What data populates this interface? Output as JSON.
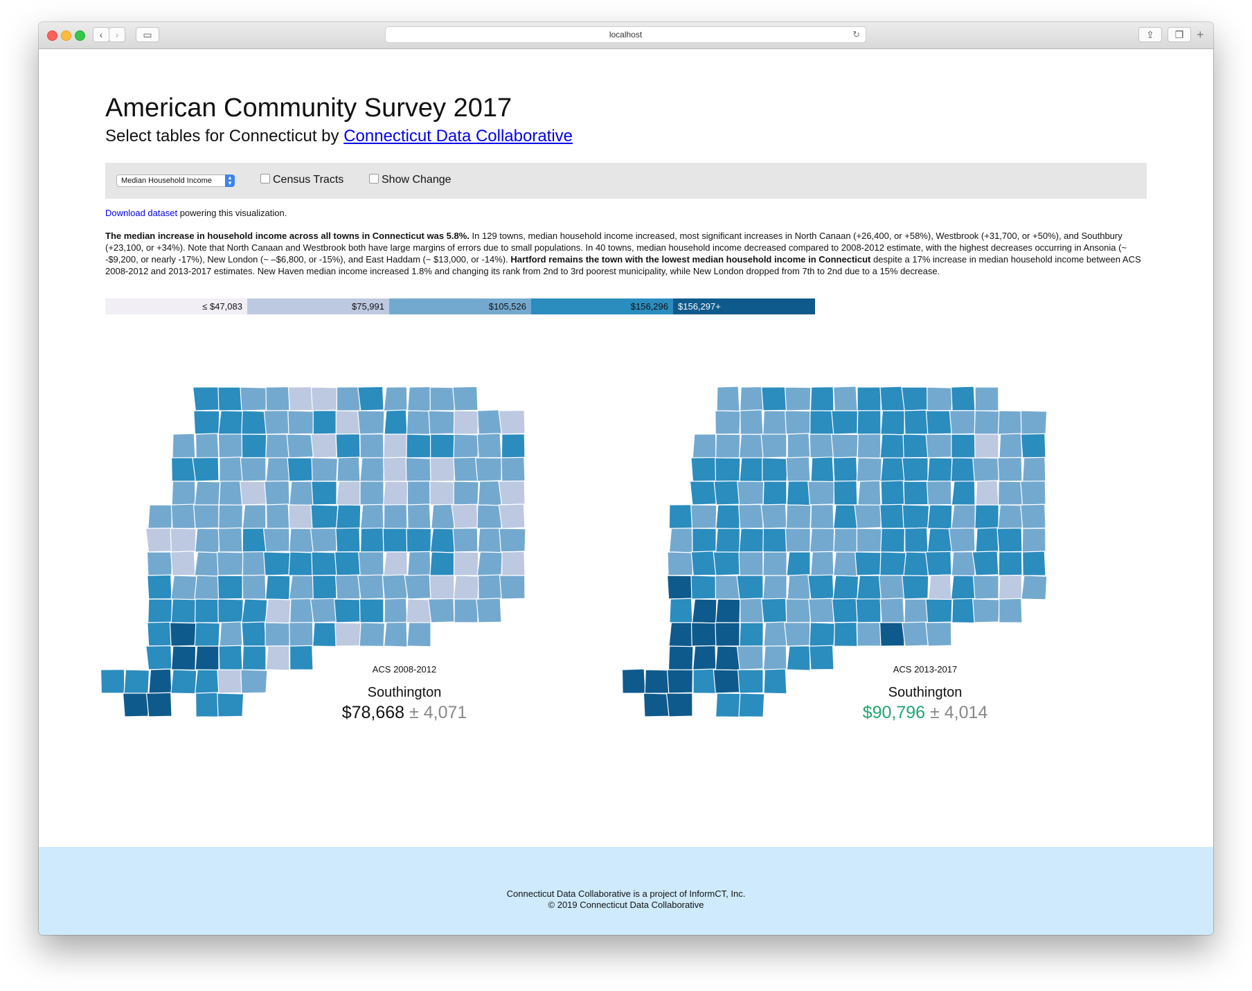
{
  "browser": {
    "url": "localhost"
  },
  "page": {
    "title": "American Community Survey 2017",
    "subtitle_prefix": "Select tables for Connecticut by",
    "subtitle_link": "Connecticut Data Collaborative"
  },
  "controls": {
    "select_value": "Median Household Income",
    "census_tracts_label": "Census Tracts",
    "census_tracts_checked": false,
    "show_change_label": "Show Change",
    "show_change_checked": false
  },
  "download": {
    "link_text": "Download dataset",
    "rest_text": " powering this visualization."
  },
  "summary": {
    "bold1": "The median increase in household income across all towns in Connecticut was 5.8%.",
    "text1": " In 129 towns, median household income increased, most significant increases in North Canaan (+26,400, or +58%), Westbrook (+31,700, or +50%), and Southbury (+23,100, or +34%). Note that North Canaan and Westbrook both have large margins of errors due to small populations. In 40 towns, median household income decreased compared to 2008-2012 estimate, with the highest decreases occurring in Ansonia (~ -$9,200, or nearly -17%), New London (~ –$6,800, or -15%), and East Haddam (~ $13,000, or -14%). ",
    "bold2": "Hartford remains the town with the lowest median household income in Connecticut",
    "text2": " despite a 17% increase in median household income between ACS 2008-2012 and 2013-2017 estimates. New Haven median income increased 1.8% and changing its rank from 2nd to 3rd poorest municipality, while New London dropped from 7th to 2nd due to a 15% decrease."
  },
  "legend": [
    {
      "label": "≤ $47,083",
      "color": "#f1eef6"
    },
    {
      "label": "$75,991",
      "color": "#bdc9e1"
    },
    {
      "label": "$105,526",
      "color": "#74a9cf"
    },
    {
      "label": "$156,296",
      "color": "#2b8cbe"
    },
    {
      "label": "$156,297+",
      "color": "#0f5a8c"
    }
  ],
  "maps": [
    {
      "period": "ACS 2008-2012",
      "town": "Southington",
      "value": "$78,668",
      "moe": "± 4,071",
      "shift": 0
    },
    {
      "period": "ACS 2013-2017",
      "town": "Southington",
      "value": "$90,796",
      "moe": "± 4,014",
      "shift": 1
    }
  ],
  "footer": {
    "line1": "Connecticut Data Collaborative is a project of InformCT, Inc.",
    "line2": "© 2019 Connecticut Data Collaborative"
  }
}
